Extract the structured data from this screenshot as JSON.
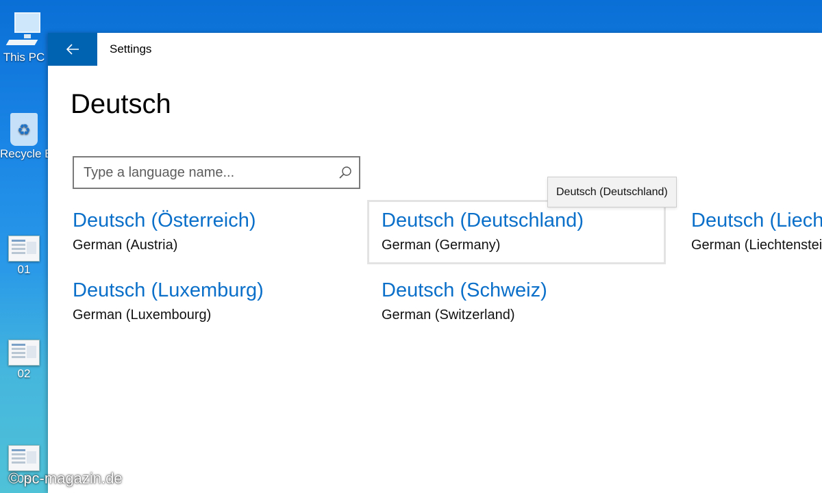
{
  "desktop": {
    "icons": [
      {
        "label": "This PC",
        "icon": "computer-icon"
      },
      {
        "label": "Recycle Bin",
        "icon": "recycle-bin-icon"
      },
      {
        "label": "01",
        "icon": "screenshot-thumbnail"
      },
      {
        "label": "02",
        "icon": "screenshot-thumbnail"
      },
      {
        "label": "03",
        "icon": "screenshot-thumbnail"
      }
    ]
  },
  "window": {
    "back_icon": "arrow-left-icon",
    "title": "Settings"
  },
  "page": {
    "title": "Deutsch"
  },
  "search": {
    "placeholder": "Type a language name...",
    "value": "",
    "icon": "search-icon"
  },
  "languages": [
    {
      "name": "Deutsch (Österreich)",
      "english": "German (Austria)",
      "selected": false
    },
    {
      "name": "Deutsch (Deutschland)",
      "english": "German (Germany)",
      "selected": true
    },
    {
      "name": "Deutsch (Liechtenstein)",
      "english": "German (Liechtenstein)",
      "selected": false
    },
    {
      "name": "Deutsch (Luxemburg)",
      "english": "German (Luxembourg)",
      "selected": false
    },
    {
      "name": "Deutsch (Schweiz)",
      "english": "German (Switzerland)",
      "selected": false
    }
  ],
  "tooltip": {
    "text": "Deutsch (Deutschland)"
  },
  "watermark": "© pc-magazin.de",
  "colors": {
    "accent": "#0063b1",
    "link": "#0a6fc9",
    "desktop": "#1b86e6"
  }
}
